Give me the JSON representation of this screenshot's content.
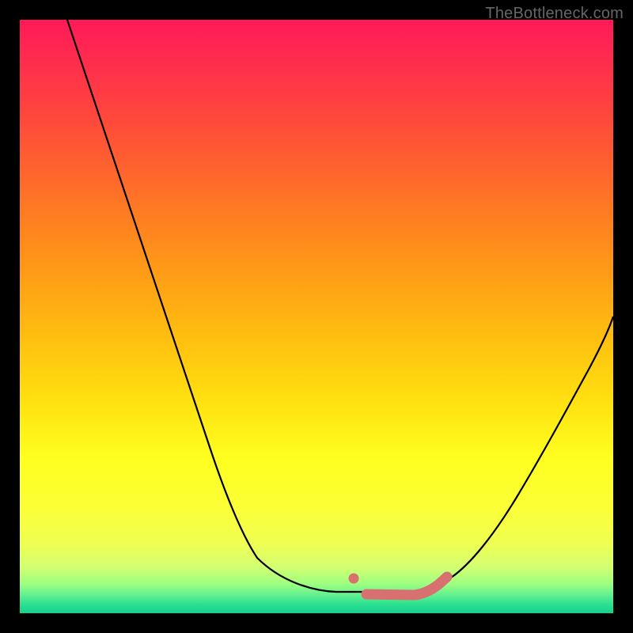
{
  "attribution": "TheBottleneck.com",
  "chart_data": {
    "type": "line",
    "title": "",
    "xlabel": "",
    "ylabel": "",
    "xlim": [
      0,
      100
    ],
    "ylim": [
      0,
      100
    ],
    "series": [
      {
        "name": "bottleneck-curve",
        "x": [
          8,
          12,
          16,
          20,
          24,
          28,
          32,
          36,
          40,
          44,
          48,
          52,
          56,
          59,
          62,
          65,
          68,
          72,
          76,
          80,
          84,
          88,
          92,
          96,
          100
        ],
        "y": [
          100,
          92,
          84,
          76,
          68,
          60,
          52,
          44,
          36,
          28,
          20,
          13,
          7,
          3,
          1,
          0.5,
          0.5,
          1,
          3,
          7,
          13,
          20,
          27,
          35,
          43
        ],
        "stroke": "#000000"
      }
    ],
    "highlight": {
      "name": "optimum-segment",
      "color": "#d97070",
      "x_range": [
        58,
        72
      ],
      "y_approx": 0.5
    },
    "annotations": []
  }
}
